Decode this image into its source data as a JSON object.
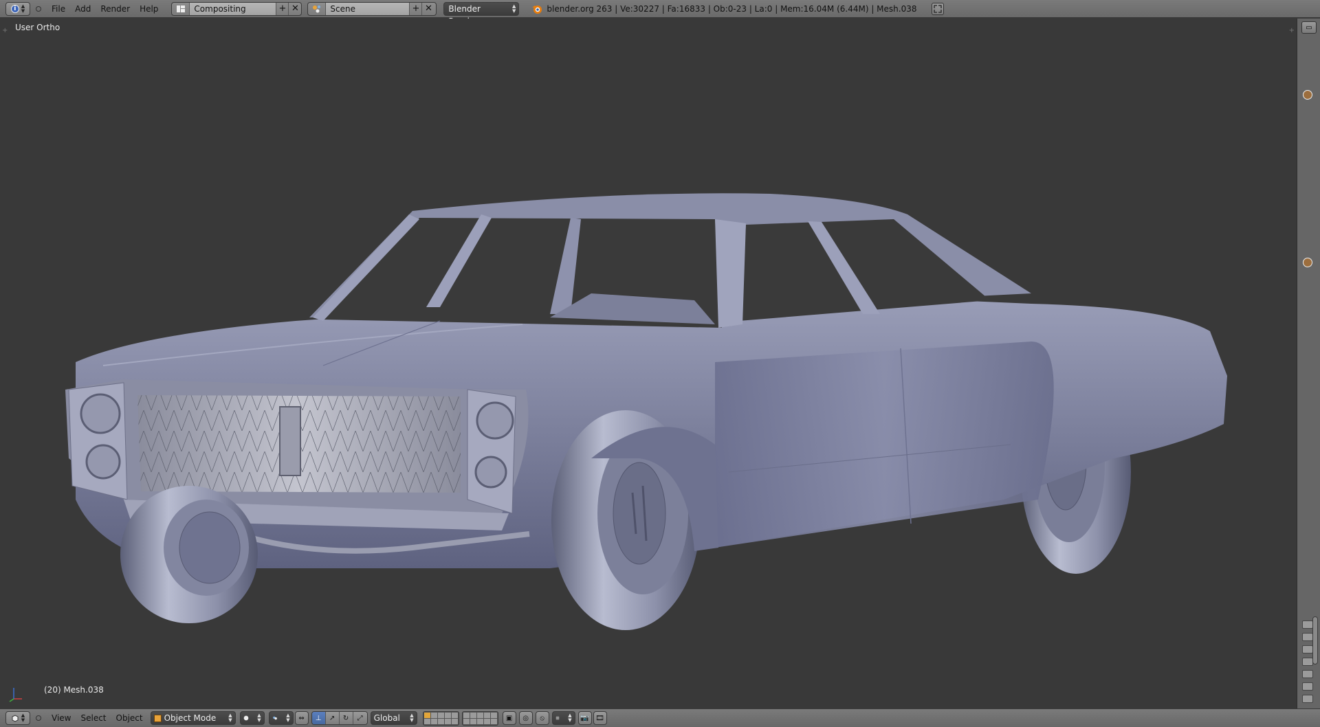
{
  "info_header": {
    "editor_icon": "info-icon",
    "menu": [
      "File",
      "Add",
      "Render",
      "Help"
    ],
    "screen_layout": "Compositing",
    "scene": "Scene",
    "render_engine": "Blender Render",
    "stats": "blender.org 263 | Ve:30227 | Fa:16833 | Ob:0-23 | La:0 | Mem:16.04M (6.44M) | Mesh.038"
  },
  "viewport": {
    "view_label": "User Ortho",
    "object_info": "(20) Mesh.038",
    "model": "car-mesh",
    "colors": {
      "background": "#393939",
      "mesh": "#8589a6"
    }
  },
  "view3d_header": {
    "menu": [
      "View",
      "Select",
      "Object"
    ],
    "mode": "Object Mode",
    "transform_orientation": "Global"
  }
}
